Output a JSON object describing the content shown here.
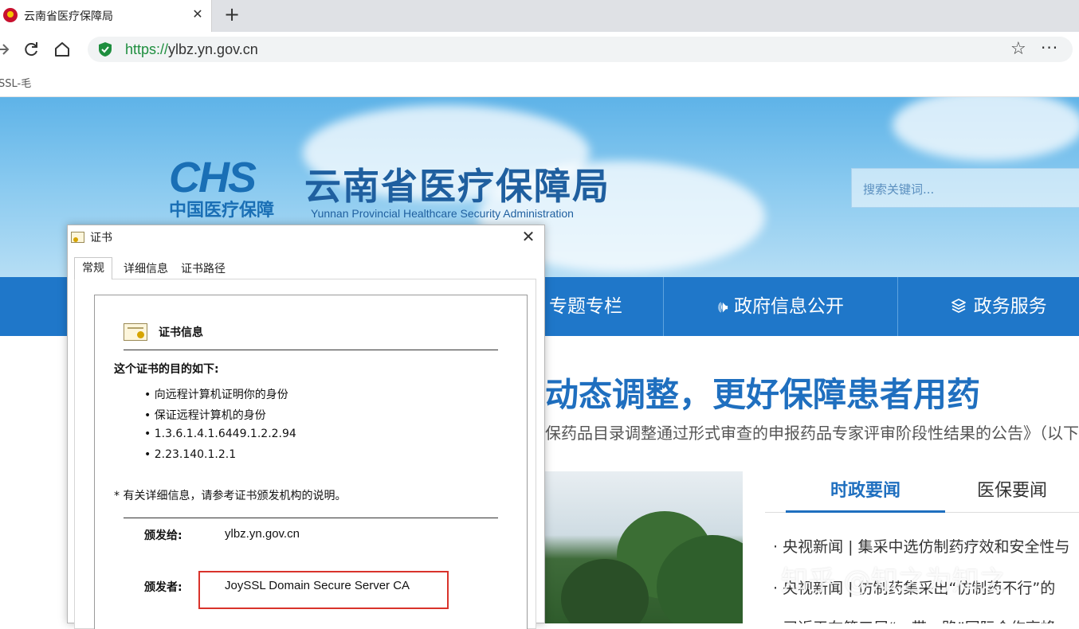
{
  "browser": {
    "tab_title": "云南省医疗保障局",
    "tab_close": "✕",
    "new_tab": "+",
    "url_scheme": "https://",
    "url_host": "ylbz.yn.gov.cn",
    "favorites_item": "SSL-毛",
    "icons": [
      "back-icon",
      "refresh-icon",
      "home-icon",
      "shield-icon",
      "star-icon",
      "more-icon"
    ]
  },
  "site": {
    "logo_letters": "CHS",
    "logo_cn": "中国医疗保障",
    "title": "云南省医疗保障局",
    "subtitle": "Yunnan Provincial Healthcare Security Administration",
    "search_placeholder": "搜索关键词...",
    "nav": [
      "专题专栏",
      "政府信息公开",
      "政务服务"
    ],
    "headline": "动态调整，更好保障患者用药",
    "subhead": "保药品目录调整通过形式审查的申报药品专家评审阶段性结果的公告》（以下",
    "news_tabs": [
      "时政要闻",
      "医保要闻"
    ],
    "news_items": [
      "· 央视新闻 | 集采中选仿制药疗效和安全性与",
      "· 央视新闻 | 仿制药集采出“仿制药不行”的",
      "· 习近平在第三届“一带一路”国际合作高峰"
    ],
    "watermark": "知乎 @知之为知之",
    "accent": "#1f77c9"
  },
  "dialog": {
    "title": "证书",
    "close": "✕",
    "tabs": [
      "常规",
      "详细信息",
      "证书路径"
    ],
    "cert_info_heading": "证书信息",
    "purpose_title": "这个证书的目的如下:",
    "purposes": [
      "• 向远程计算机证明你的身份",
      "• 保证远程计算机的身份",
      "• 1.3.6.1.4.1.6449.1.2.2.94",
      "• 2.23.140.1.2.1"
    ],
    "note": "* 有关详细信息，请参考证书颁发机构的说明。",
    "issued_to_label": "颁发给:",
    "issued_to_value": "ylbz.yn.gov.cn",
    "issued_by_label": "颁发者:",
    "issued_by_value": "JoySSL Domain Secure Server CA",
    "highlight_color": "#d9332b"
  }
}
